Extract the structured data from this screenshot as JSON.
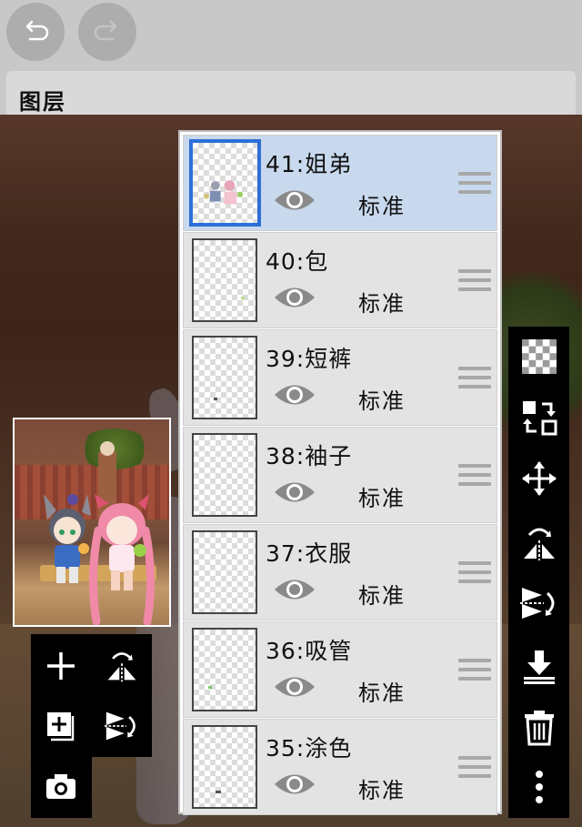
{
  "toolbar": {
    "undo_icon": "undo-arrow-icon",
    "redo_icon": "redo-arrow-icon"
  },
  "panel": {
    "title": "图层"
  },
  "layers": [
    {
      "name": "41:姐弟",
      "blend": "标准",
      "selected": true
    },
    {
      "name": "40:包",
      "blend": "标准",
      "selected": false
    },
    {
      "name": "39:短裤",
      "blend": "标准",
      "selected": false
    },
    {
      "name": "38:袖子",
      "blend": "标准",
      "selected": false
    },
    {
      "name": "37:衣服",
      "blend": "标准",
      "selected": false
    },
    {
      "name": "36:吸管",
      "blend": "标准",
      "selected": false
    },
    {
      "name": "35:涂色",
      "blend": "标准",
      "selected": false
    }
  ],
  "right_tools": [
    "transparency-checker-icon",
    "swap-layer-icon",
    "move-icon",
    "flip-horizontal-icon",
    "flip-vertical-icon",
    "merge-down-icon",
    "trash-icon",
    "more-vertical-icon"
  ],
  "left_tools": [
    "add-layer-icon",
    "flip-horizontal-icon",
    "copy-layer-icon",
    "flip-vertical-icon",
    "camera-icon"
  ],
  "colors": {
    "selected_row": "#c8d9ee",
    "selected_border": "#2d6fd6",
    "tool_bg": "#000000"
  }
}
